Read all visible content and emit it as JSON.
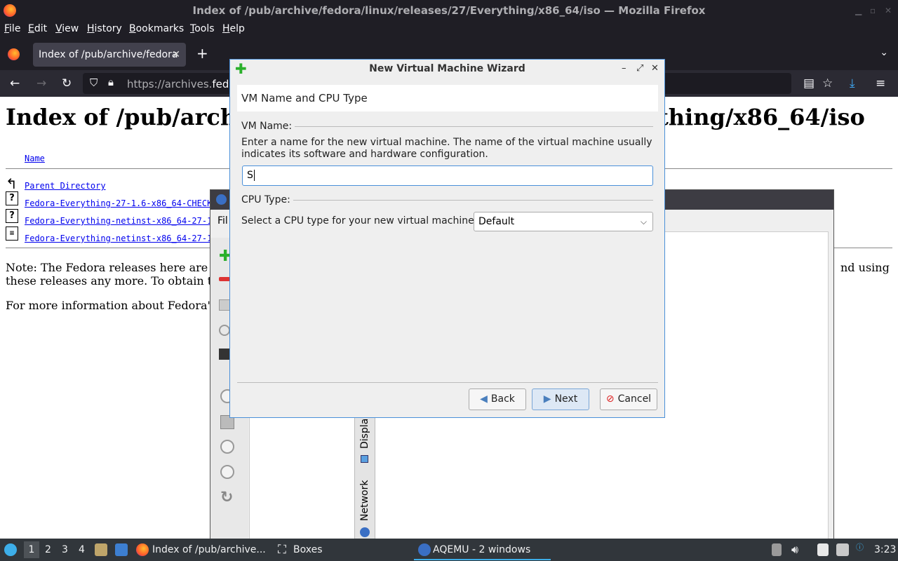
{
  "firefox": {
    "window_title": "Index of /pub/archive/fedora/linux/releases/27/Everything/x86_64/iso — Mozilla Firefox",
    "menu": [
      "File",
      "Edit",
      "View",
      "History",
      "Bookmarks",
      "Tools",
      "Help"
    ],
    "tab_title": "Index of /pub/archive/fedora",
    "url_prefix": "https://archives.",
    "url_host": "fedo"
  },
  "page": {
    "heading_left": "Index of /pub/arch",
    "heading_right": "thing/x86_64/iso",
    "column_name": "Name",
    "rows": [
      "Parent Directory",
      "Fedora-Everything-27-1.6-x86_64-CHECK",
      "Fedora-Everything-netinst-x86_64-27-1",
      "Fedora-Everything-netinst-x86_64-27-1"
    ],
    "note_line1": "Note: The Fedora releases here are",
    "note_line1_end": "nd using",
    "note_line2": "these releases any more. To obtain t",
    "more_info": "For more information about Fedora'"
  },
  "aqemu": {
    "menu_fragment": "Fil",
    "tab_display": "Displa",
    "tab_network": "Network"
  },
  "dialog": {
    "title": "New Virtual Machine Wizard",
    "header": "VM Name and CPU Type",
    "vm_name_group": "VM Name:",
    "vm_name_desc_1": "Enter a name for the new virtual machine. The name of the virtual machine usually",
    "vm_name_desc_2": "indicates its software and hardware configuration.",
    "vm_name_value": "S",
    "cpu_group": "CPU Type:",
    "cpu_label": "Select a CPU type for your new virtual machine:",
    "cpu_selected": "Default",
    "back_label": "Back",
    "next_label": "Next",
    "cancel_label": "Cancel"
  },
  "taskbar": {
    "desktops": [
      "1",
      "2",
      "3",
      "4"
    ],
    "tasks": [
      {
        "label": "Index of /pub/archive..."
      },
      {
        "label": "Boxes"
      },
      {
        "label": "AQEMU - 2 windows"
      }
    ],
    "clock": "3:23"
  }
}
